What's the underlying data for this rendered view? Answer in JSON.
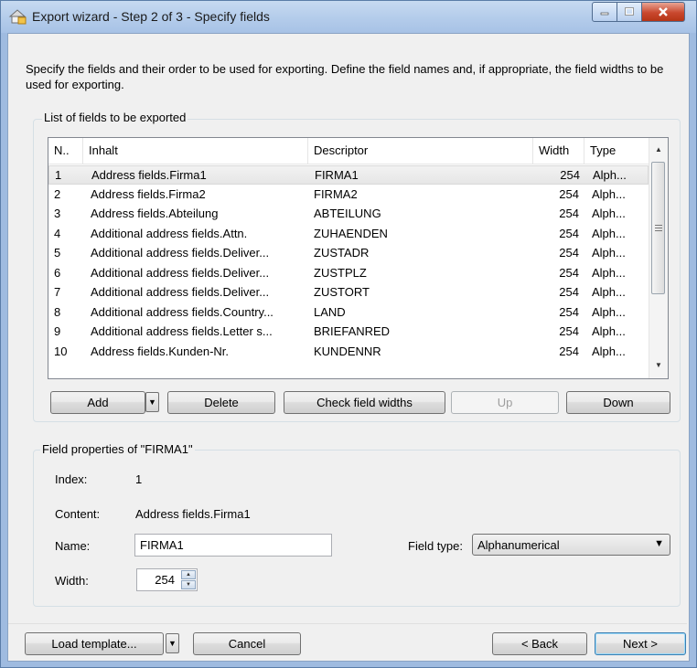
{
  "window": {
    "title": "Export wizard - Step 2 of 3 - Specify fields",
    "minimize_icon": "minimize-icon",
    "maximize_icon": "maximize-icon",
    "close_icon": "close-icon"
  },
  "description": "Specify the fields and their order to be used for exporting. Define the field names and, if appropriate, the field widths to be used for exporting.",
  "fields_group": {
    "label": "List of fields to be exported",
    "columns": [
      "N..",
      "Inhalt",
      "Descriptor",
      "Width",
      "Type"
    ],
    "rows": [
      {
        "n": "1",
        "inhalt": "Address fields.Firma1",
        "descriptor": "FIRMA1",
        "width": "254",
        "type": "Alph..."
      },
      {
        "n": "2",
        "inhalt": "Address fields.Firma2",
        "descriptor": "FIRMA2",
        "width": "254",
        "type": "Alph..."
      },
      {
        "n": "3",
        "inhalt": "Address fields.Abteilung",
        "descriptor": "ABTEILUNG",
        "width": "254",
        "type": "Alph..."
      },
      {
        "n": "4",
        "inhalt": "Additional address fields.Attn.",
        "descriptor": "ZUHAENDEN",
        "width": "254",
        "type": "Alph..."
      },
      {
        "n": "5",
        "inhalt": "Additional address fields.Deliver...",
        "descriptor": "ZUSTADR",
        "width": "254",
        "type": "Alph..."
      },
      {
        "n": "6",
        "inhalt": "Additional address fields.Deliver...",
        "descriptor": "ZUSTPLZ",
        "width": "254",
        "type": "Alph..."
      },
      {
        "n": "7",
        "inhalt": "Additional address fields.Deliver...",
        "descriptor": "ZUSTORT",
        "width": "254",
        "type": "Alph..."
      },
      {
        "n": "8",
        "inhalt": "Additional address fields.Country...",
        "descriptor": "LAND",
        "width": "254",
        "type": "Alph..."
      },
      {
        "n": "9",
        "inhalt": "Additional address fields.Letter s...",
        "descriptor": "BRIEFANRED",
        "width": "254",
        "type": "Alph..."
      },
      {
        "n": "10",
        "inhalt": "Address fields.Kunden-Nr.",
        "descriptor": "KUNDENNR",
        "width": "254",
        "type": "Alph..."
      }
    ],
    "selected_row": 0,
    "buttons": {
      "add": "Add",
      "delete": "Delete",
      "check_widths": "Check field widths",
      "up": "Up",
      "down": "Down"
    }
  },
  "properties_group": {
    "label": "Field properties of \"FIRMA1\"",
    "index_label": "Index:",
    "index_value": "1",
    "content_label": "Content:",
    "content_value": "Address fields.Firma1",
    "name_label": "Name:",
    "name_value": "FIRMA1",
    "field_type_label": "Field type:",
    "field_type_value": "Alphanumerical",
    "width_label": "Width:",
    "width_value": "254"
  },
  "footer": {
    "load_template": "Load template...",
    "cancel": "Cancel",
    "back": "< Back",
    "next": "Next >"
  }
}
